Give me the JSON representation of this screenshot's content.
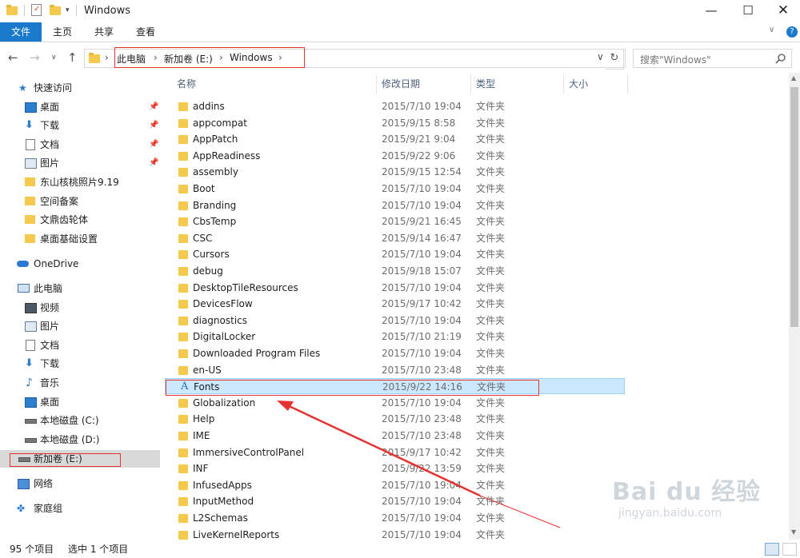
{
  "window": {
    "title": "Windows"
  },
  "ribbon": {
    "tabs": [
      "文件",
      "主页",
      "共享",
      "查看"
    ]
  },
  "address": {
    "crumbs": [
      "此电脑",
      "新加卷 (E:)",
      "Windows"
    ]
  },
  "search": {
    "placeholder": "搜索\"Windows\""
  },
  "nav": {
    "quick_access": "快速访问",
    "quick_items": [
      "桌面",
      "下载",
      "文档",
      "图片",
      "东山核桃照片9.19",
      "空间备案",
      "文鼎齿轮体",
      "桌面基础设置"
    ],
    "onedrive": "OneDrive",
    "this_pc": "此电脑",
    "pc_items": [
      "视频",
      "图片",
      "文档",
      "下载",
      "音乐",
      "桌面",
      "本地磁盘 (C:)",
      "本地磁盘 (D:)",
      "新加卷 (E:)"
    ],
    "network": "网络",
    "homegroup": "家庭组"
  },
  "columns": {
    "name": "名称",
    "date": "修改日期",
    "type": "类型",
    "size": "大小"
  },
  "files": [
    {
      "name": "addins",
      "date": "2015/7/10 19:04",
      "type": "文件夹"
    },
    {
      "name": "appcompat",
      "date": "2015/9/15 8:58",
      "type": "文件夹"
    },
    {
      "name": "AppPatch",
      "date": "2015/9/21 9:04",
      "type": "文件夹"
    },
    {
      "name": "AppReadiness",
      "date": "2015/9/22 9:06",
      "type": "文件夹"
    },
    {
      "name": "assembly",
      "date": "2015/9/15 12:54",
      "type": "文件夹"
    },
    {
      "name": "Boot",
      "date": "2015/7/10 19:04",
      "type": "文件夹"
    },
    {
      "name": "Branding",
      "date": "2015/7/10 19:04",
      "type": "文件夹"
    },
    {
      "name": "CbsTemp",
      "date": "2015/9/21 16:45",
      "type": "文件夹"
    },
    {
      "name": "CSC",
      "date": "2015/9/14 16:47",
      "type": "文件夹"
    },
    {
      "name": "Cursors",
      "date": "2015/7/10 19:04",
      "type": "文件夹"
    },
    {
      "name": "debug",
      "date": "2015/9/18 15:07",
      "type": "文件夹"
    },
    {
      "name": "DesktopTileResources",
      "date": "2015/7/10 19:04",
      "type": "文件夹"
    },
    {
      "name": "DevicesFlow",
      "date": "2015/9/17 10:42",
      "type": "文件夹"
    },
    {
      "name": "diagnostics",
      "date": "2015/7/10 19:04",
      "type": "文件夹"
    },
    {
      "name": "DigitalLocker",
      "date": "2015/7/10 21:19",
      "type": "文件夹"
    },
    {
      "name": "Downloaded Program Files",
      "date": "2015/7/10 19:04",
      "type": "文件夹"
    },
    {
      "name": "en-US",
      "date": "2015/7/10 23:48",
      "type": "文件夹"
    },
    {
      "name": "Fonts",
      "date": "2015/9/22 14:16",
      "type": "文件夹"
    },
    {
      "name": "Globalization",
      "date": "2015/7/10 19:04",
      "type": "文件夹"
    },
    {
      "name": "Help",
      "date": "2015/7/10 23:48",
      "type": "文件夹"
    },
    {
      "name": "IME",
      "date": "2015/7/10 23:48",
      "type": "文件夹"
    },
    {
      "name": "ImmersiveControlPanel",
      "date": "2015/9/17 10:42",
      "type": "文件夹"
    },
    {
      "name": "INF",
      "date": "2015/9/22 13:59",
      "type": "文件夹"
    },
    {
      "name": "InfusedApps",
      "date": "2015/7/10 19:04",
      "type": "文件夹"
    },
    {
      "name": "InputMethod",
      "date": "2015/7/10 19:04",
      "type": "文件夹"
    },
    {
      "name": "L2Schemas",
      "date": "2015/7/10 19:04",
      "type": "文件夹"
    },
    {
      "name": "LiveKernelReports",
      "date": "2015/7/10 19:04",
      "type": "文件夹"
    }
  ],
  "status": {
    "count": "95 个项目",
    "selected": "选中 1 个项目"
  },
  "watermark": {
    "brand": "Bai du 经验",
    "url": "jingyan.baidu.com"
  }
}
